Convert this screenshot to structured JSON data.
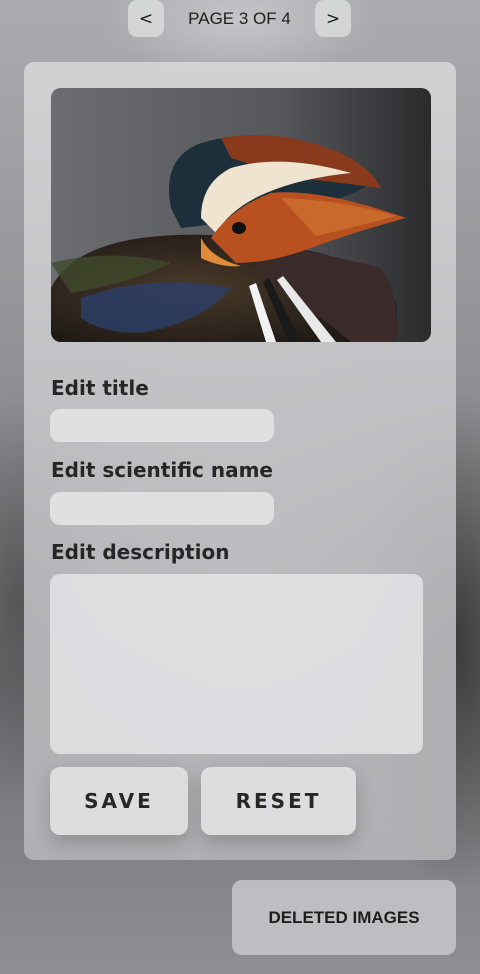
{
  "pager": {
    "prev": "<",
    "label": "PAGE 3 OF 4",
    "next": ">"
  },
  "form": {
    "title_label": "Edit title",
    "title_value": "",
    "scientific_label": "Edit scientific name",
    "scientific_value": "",
    "description_label": "Edit description",
    "description_value": ""
  },
  "actions": {
    "save": "SAVE",
    "reset": "RESET"
  },
  "deleted_images": "DELETED IMAGES"
}
